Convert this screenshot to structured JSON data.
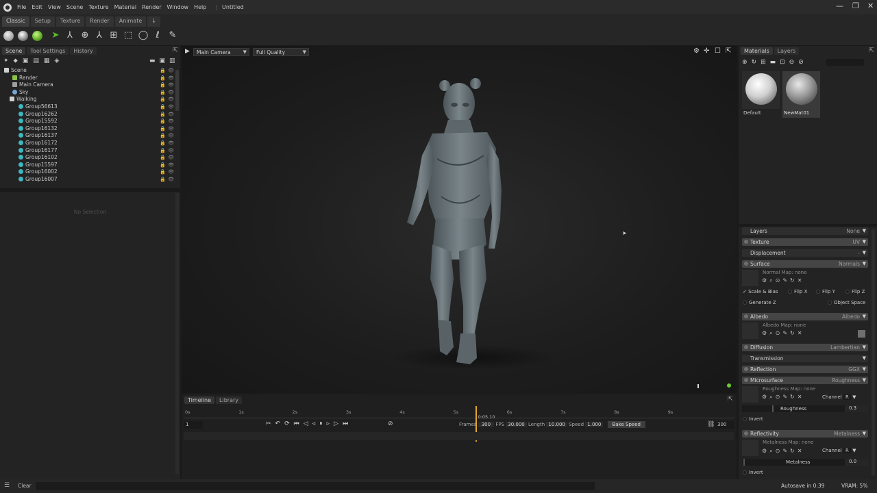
{
  "app": {
    "title": "Untitled",
    "menu": [
      "File",
      "Edit",
      "View",
      "Scene",
      "Texture",
      "Material",
      "Render",
      "Window",
      "Help"
    ]
  },
  "window_controls": {
    "minimize": "—",
    "maximize": "❐",
    "close": "✕"
  },
  "mode_tabs": [
    "Classic",
    "Setup",
    "Texture",
    "Render",
    "Animate",
    "↓"
  ],
  "left_panel": {
    "tabs": [
      "Scene",
      "Tool Settings",
      "History"
    ],
    "tree": [
      {
        "label": "Scene",
        "icon": "scene-icon"
      },
      {
        "label": "Render",
        "icon": "render-icon"
      },
      {
        "label": "Main Camera",
        "icon": "camera-icon"
      },
      {
        "label": "Sky",
        "icon": "sky-icon"
      },
      {
        "label": "Walking",
        "icon": "walking-icon"
      },
      {
        "label": "Group56613",
        "icon": "mesh-icon"
      },
      {
        "label": "Group16262",
        "icon": "mesh-icon"
      },
      {
        "label": "Group15592",
        "icon": "mesh-icon"
      },
      {
        "label": "Group16132",
        "icon": "mesh-icon"
      },
      {
        "label": "Group16137",
        "icon": "mesh-icon"
      },
      {
        "label": "Group16172",
        "icon": "mesh-icon"
      },
      {
        "label": "Group16177",
        "icon": "mesh-icon"
      },
      {
        "label": "Group16102",
        "icon": "mesh-icon"
      },
      {
        "label": "Group15597",
        "icon": "mesh-icon"
      },
      {
        "label": "Group16002",
        "icon": "mesh-icon"
      },
      {
        "label": "Group16007",
        "icon": "mesh-icon"
      }
    ],
    "no_selection": "No Selection"
  },
  "viewport": {
    "camera": "Main Camera",
    "quality": "Full Quality"
  },
  "right_panel": {
    "tabs": [
      "Materials",
      "Layers"
    ],
    "materials": [
      {
        "name": "Default"
      },
      {
        "name": "NewMat01"
      }
    ],
    "sections": {
      "layers": {
        "label": "Layers",
        "value": "None"
      },
      "texture": {
        "label": "Texture",
        "value": "UV"
      },
      "displacement": {
        "label": "Displacement",
        "value": "-"
      },
      "surface": {
        "label": "Surface",
        "value": "Normals",
        "map": "Normal Map: none"
      },
      "scale_bias": "Scale & Bias",
      "flip_x": "Flip X",
      "flip_y": "Flip Y",
      "flip_z": "Flip Z",
      "generate_z": "Generate Z",
      "object_space": "Object Space",
      "albedo": {
        "label": "Albedo",
        "value": "Albedo",
        "map": "Albedo Map: none"
      },
      "diffusion": {
        "label": "Diffusion",
        "value": "Lambertian"
      },
      "transmission": {
        "label": "Transmission",
        "value": ""
      },
      "reflection": {
        "label": "Reflection",
        "value": "GGX"
      },
      "microsurface": {
        "label": "Microsurface",
        "value": "Roughness",
        "map": "Roughness Map: none",
        "channel_label": "Channel",
        "channel": "R"
      },
      "roughness": {
        "label": "Roughness",
        "value": "0.3"
      },
      "invert": "Invert",
      "reflectivity": {
        "label": "Reflectivity",
        "value": "Metalness",
        "map": "Metalness Map: none",
        "channel_label": "Channel",
        "channel": "R"
      },
      "metalness": {
        "label": "Metalness",
        "value": "0.0"
      },
      "invert2": "Invert"
    }
  },
  "timeline": {
    "tabs": [
      "Timeline",
      "Library"
    ],
    "ticks": [
      "0s",
      "1s",
      "2s",
      "3s",
      "4s",
      "5s",
      "6s",
      "7s",
      "8s",
      "9s"
    ],
    "current_time": "0:05.10",
    "frame": "1",
    "frames_label": "Frames",
    "frames": "300",
    "fps_label": "FPS",
    "fps": "30.000",
    "length_label": "Length",
    "length": "10.000",
    "speed_label": "Speed",
    "speed": "1.000",
    "bake_speed": "Bake Speed",
    "end_frame": "300",
    "playhead_fraction": 0.53
  },
  "status": {
    "clear": "Clear",
    "autosave": "Autosave in 0:39",
    "vram": "VRAM: 5%"
  }
}
